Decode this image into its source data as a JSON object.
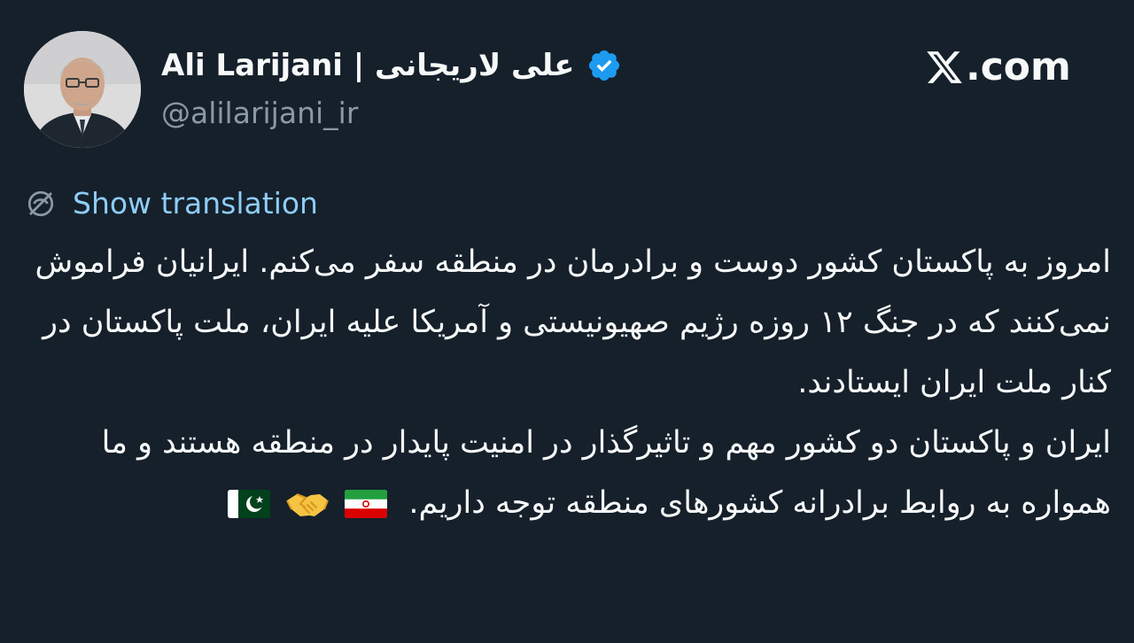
{
  "header": {
    "display_name": "Ali Larijani | علی لاریجانی",
    "handle": "@alilarijani_ir",
    "brand": ".com",
    "avatar_icon": "profile-photo",
    "verified_icon": "verified-badge-icon",
    "brand_icon": "x-logo-icon"
  },
  "translation": {
    "label": "Show translation",
    "icon": "translate-globe-icon"
  },
  "tweet": {
    "paragraph1": "امروز به پاکستان کشور دوست و برادرمان در منطقه سفر می‌کنم. ایرانیان فراموش نمی‌کنند که در جنگ ۱۲ روزه رژیم صهیونیستی و آمریکا علیه ایران، ملت پاکستان در کنار ملت ایران ایستادند.",
    "paragraph2": "ایران و پاکستان دو کشور مهم و تاثیرگذار در امنیت پایدار در منطقه هستند و ما همواره به روابط برادرانه کشورهای منطقه توجه داریم.",
    "emojis": [
      "flag-iran",
      "handshake",
      "flag-pakistan"
    ]
  },
  "colors": {
    "background": "#15202b",
    "text_primary": "#f7f9f9",
    "text_secondary": "#8b98a5",
    "link": "#8ecdf8",
    "verified": "#1d9bf0"
  }
}
